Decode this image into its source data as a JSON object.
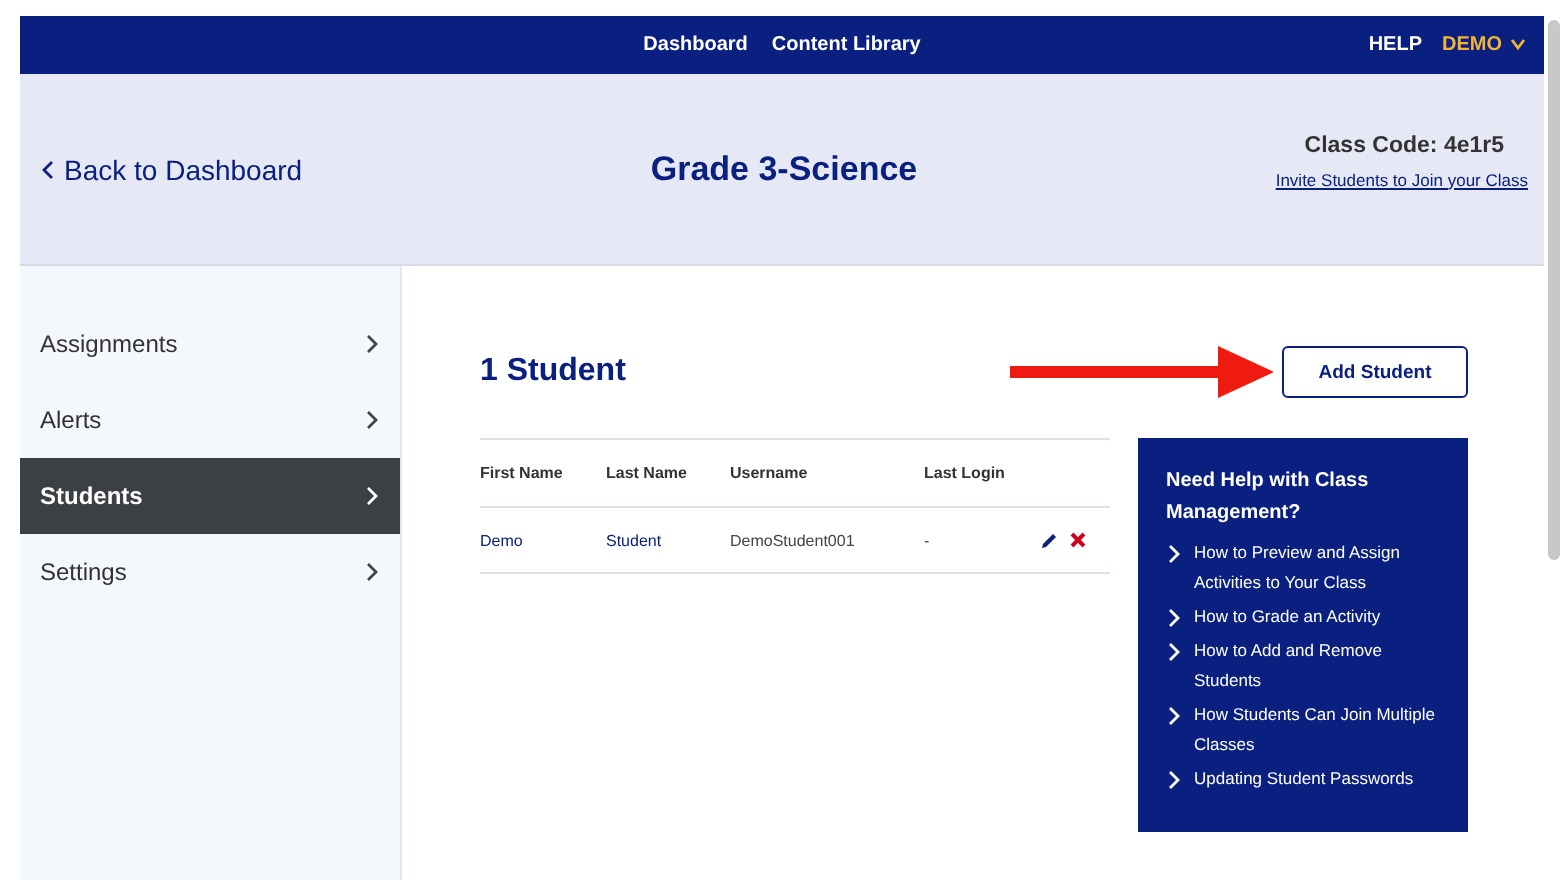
{
  "top_nav": {
    "links": [
      "Dashboard",
      "Content Library"
    ],
    "help": "HELP",
    "user": "DEMO"
  },
  "header": {
    "back": "Back to Dashboard",
    "title": "Grade 3-Science",
    "class_code": "Class Code: 4e1r5",
    "invite_link": "Invite Students to Join your Class"
  },
  "sidebar": {
    "items": [
      {
        "label": "Assignments",
        "selected": false
      },
      {
        "label": "Alerts",
        "selected": false
      },
      {
        "label": "Students",
        "selected": true
      },
      {
        "label": "Settings",
        "selected": false
      }
    ]
  },
  "main": {
    "heading": "1 Student",
    "add_button": "Add Student",
    "table": {
      "columns": [
        "First Name",
        "Last Name",
        "Username",
        "Last Login"
      ],
      "rows": [
        {
          "cells": [
            "Demo",
            "Student",
            "DemoStudent001",
            "-"
          ]
        }
      ]
    },
    "help": {
      "title": "Need Help with Class Management?",
      "links": [
        "How to Preview and Assign Activities to Your Class",
        "How to Grade an Activity",
        "How to Add and Remove Students",
        "How Students Can Join Multiple Classes",
        "Updating Student Passwords"
      ]
    }
  }
}
